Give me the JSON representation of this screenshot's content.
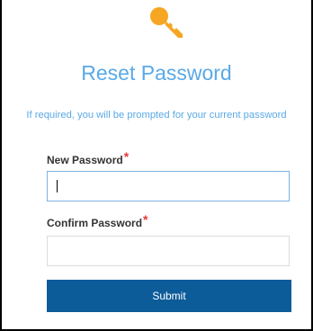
{
  "page": {
    "title": "Reset Password",
    "subtitle": "If required, you will be prompted for your current password"
  },
  "form": {
    "new_password": {
      "label": "New Password",
      "required_marker": "*",
      "value": ""
    },
    "confirm_password": {
      "label": "Confirm Password",
      "required_marker": "*",
      "value": ""
    },
    "submit_label": "Submit"
  },
  "icons": {
    "header": "key-icon"
  },
  "colors": {
    "accent": "#5aa9e6",
    "button": "#0d5c9a",
    "required": "#e53935",
    "key": "#f5a623"
  }
}
